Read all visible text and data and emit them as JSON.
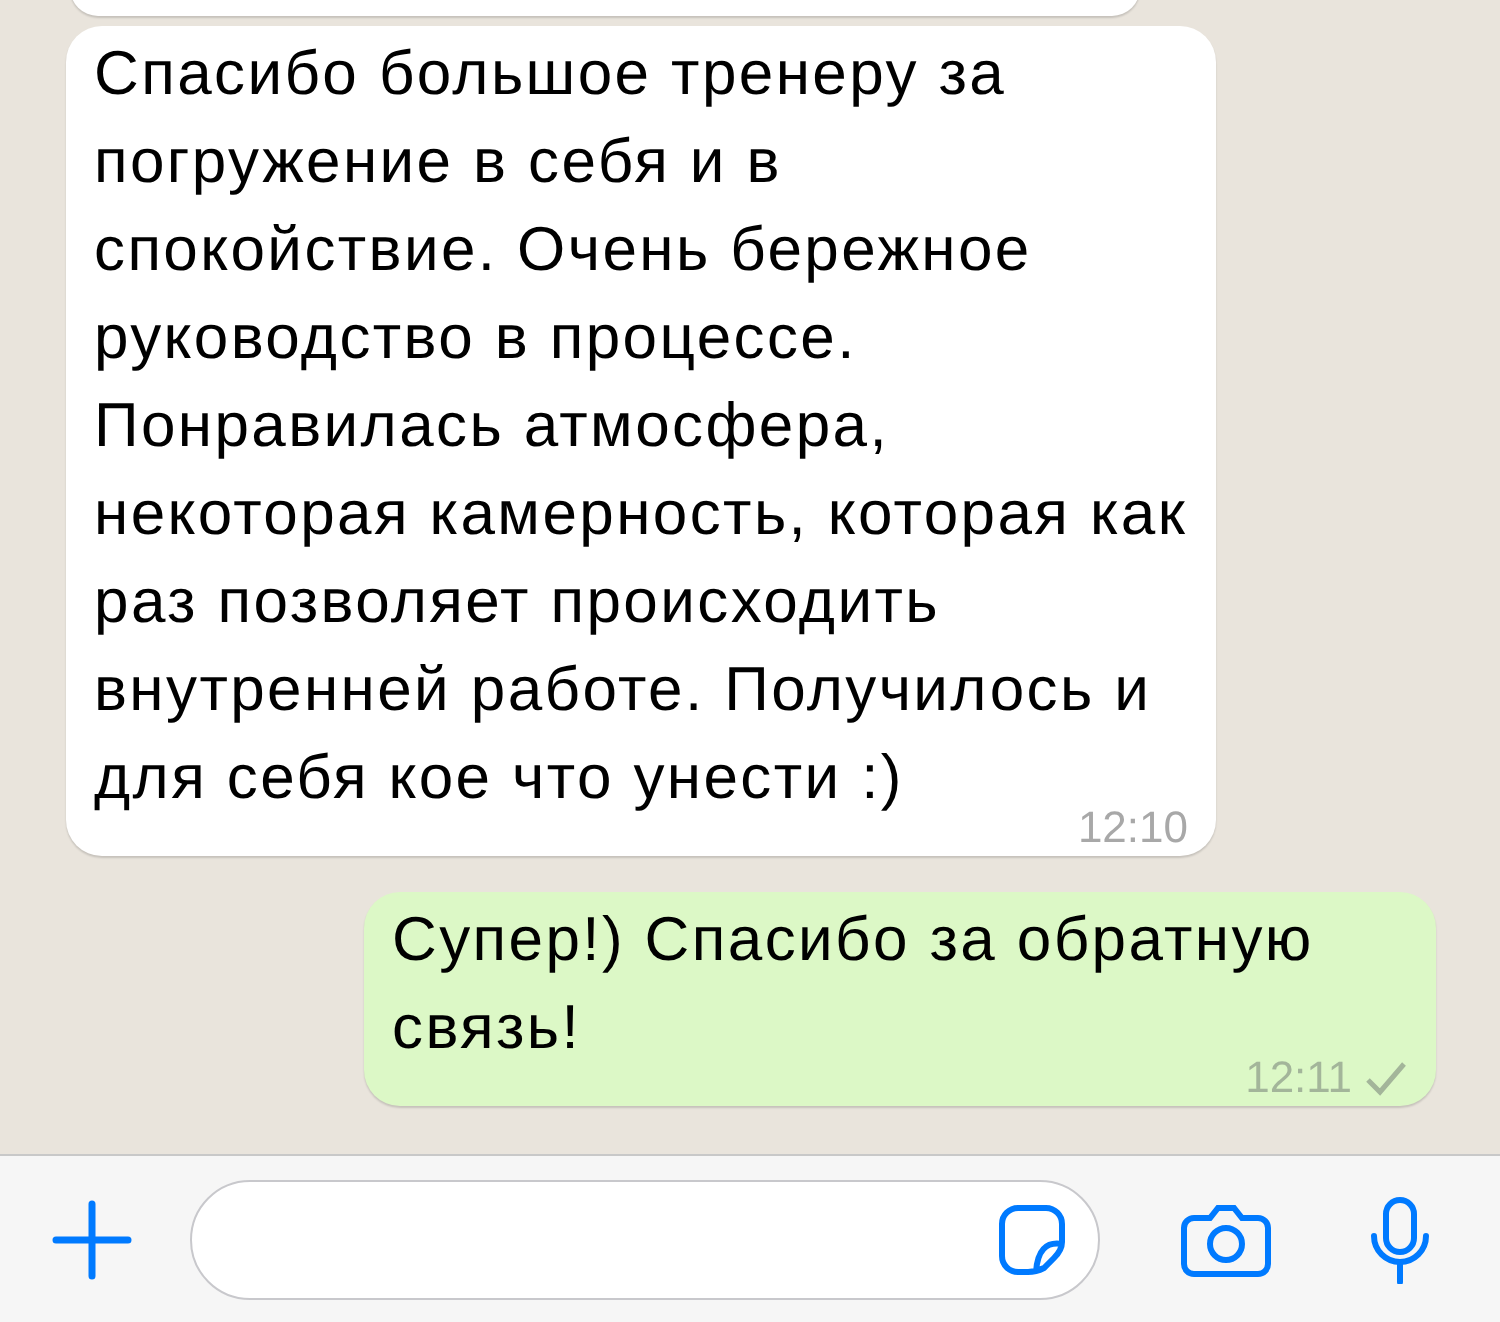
{
  "messages": [
    {
      "kind": "incoming"
    },
    {
      "kind": "incoming",
      "text": "Спасибо большое тренеру за погружение в себя и в спокойствие. Очень бережное руководство в процессе. Понравилась атмосфера, некоторая камерность, которая как раз позволяет происходить внутренней работе. Получилось и для себя кое что унести :)",
      "time": "12:10"
    },
    {
      "kind": "outgoing",
      "text": "Супер!) Спасибо за обратную связь!",
      "time": "12:11",
      "delivered": true
    }
  ]
}
